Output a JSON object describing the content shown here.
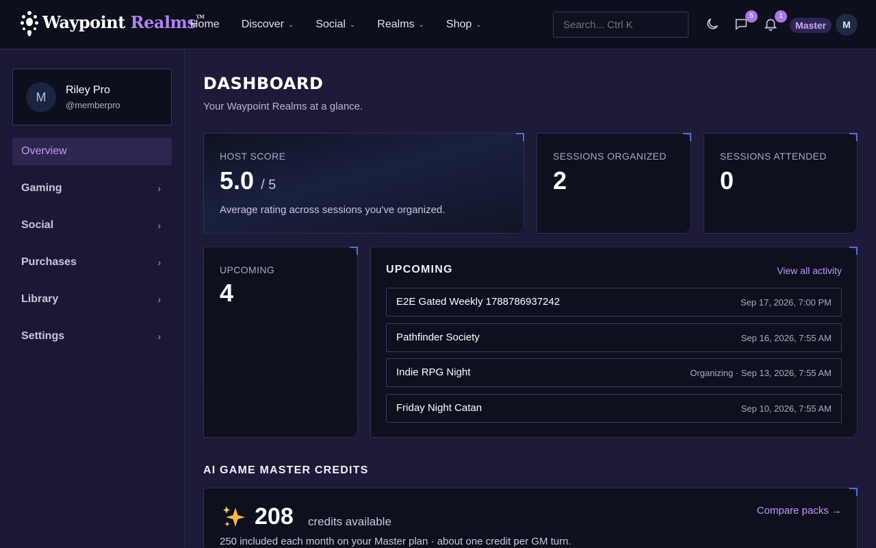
{
  "brand": {
    "name": "Waypoint",
    "name_accent": "Realms",
    "tm": "TM"
  },
  "nav": {
    "items": [
      {
        "label": "Home",
        "dropdown": false
      },
      {
        "label": "Discover",
        "dropdown": true
      },
      {
        "label": "Social",
        "dropdown": true
      },
      {
        "label": "Realms",
        "dropdown": true
      },
      {
        "label": "Shop",
        "dropdown": true
      }
    ],
    "search_placeholder": "Search... Ctrl K",
    "messages_badge": "5",
    "notifications_badge": "1",
    "role": "Master",
    "avatar_initial": "M"
  },
  "sidebar": {
    "profile": {
      "initial": "M",
      "name": "Riley Pro",
      "handle": "@memberpro"
    },
    "items": [
      {
        "label": "Overview",
        "active": true
      },
      {
        "label": "Gaming",
        "active": false
      },
      {
        "label": "Social",
        "active": false
      },
      {
        "label": "Purchases",
        "active": false
      },
      {
        "label": "Library",
        "active": false
      },
      {
        "label": "Settings",
        "active": false
      }
    ]
  },
  "page": {
    "title": "DASHBOARD",
    "subtitle": "Your Waypoint Realms at a glance."
  },
  "stats": {
    "host_score": {
      "label": "HOST SCORE",
      "value": "5.0",
      "suffix": "/ 5",
      "desc": "Average rating across sessions you've organized."
    },
    "sessions_organized": {
      "label": "SESSIONS ORGANIZED",
      "value": "2"
    },
    "sessions_attended": {
      "label": "SESSIONS ATTENDED",
      "value": "0"
    },
    "upcoming": {
      "label": "UPCOMING",
      "value": "4"
    }
  },
  "upcoming_panel": {
    "title": "UPCOMING",
    "view_all": "View all activity",
    "events": [
      {
        "name": "E2E Gated Weekly 1788786937242",
        "date": "Sep 17, 2026, 7:00 PM"
      },
      {
        "name": "Pathfinder Society",
        "date": "Sep 16, 2026, 7:55 AM"
      },
      {
        "name": "Indie RPG Night",
        "date": "Organizing · Sep 13, 2026, 7:55 AM"
      },
      {
        "name": "Friday Night Catan",
        "date": "Sep 10, 2026, 7:55 AM"
      }
    ]
  },
  "credits": {
    "section_title": "AI GAME MASTER CREDITS",
    "icon": "sparkles-icon",
    "amount": "208",
    "label": "credits available",
    "desc": "250 included each month on your Master plan · about one credit per GM turn.",
    "compare": "Compare packs →"
  }
}
